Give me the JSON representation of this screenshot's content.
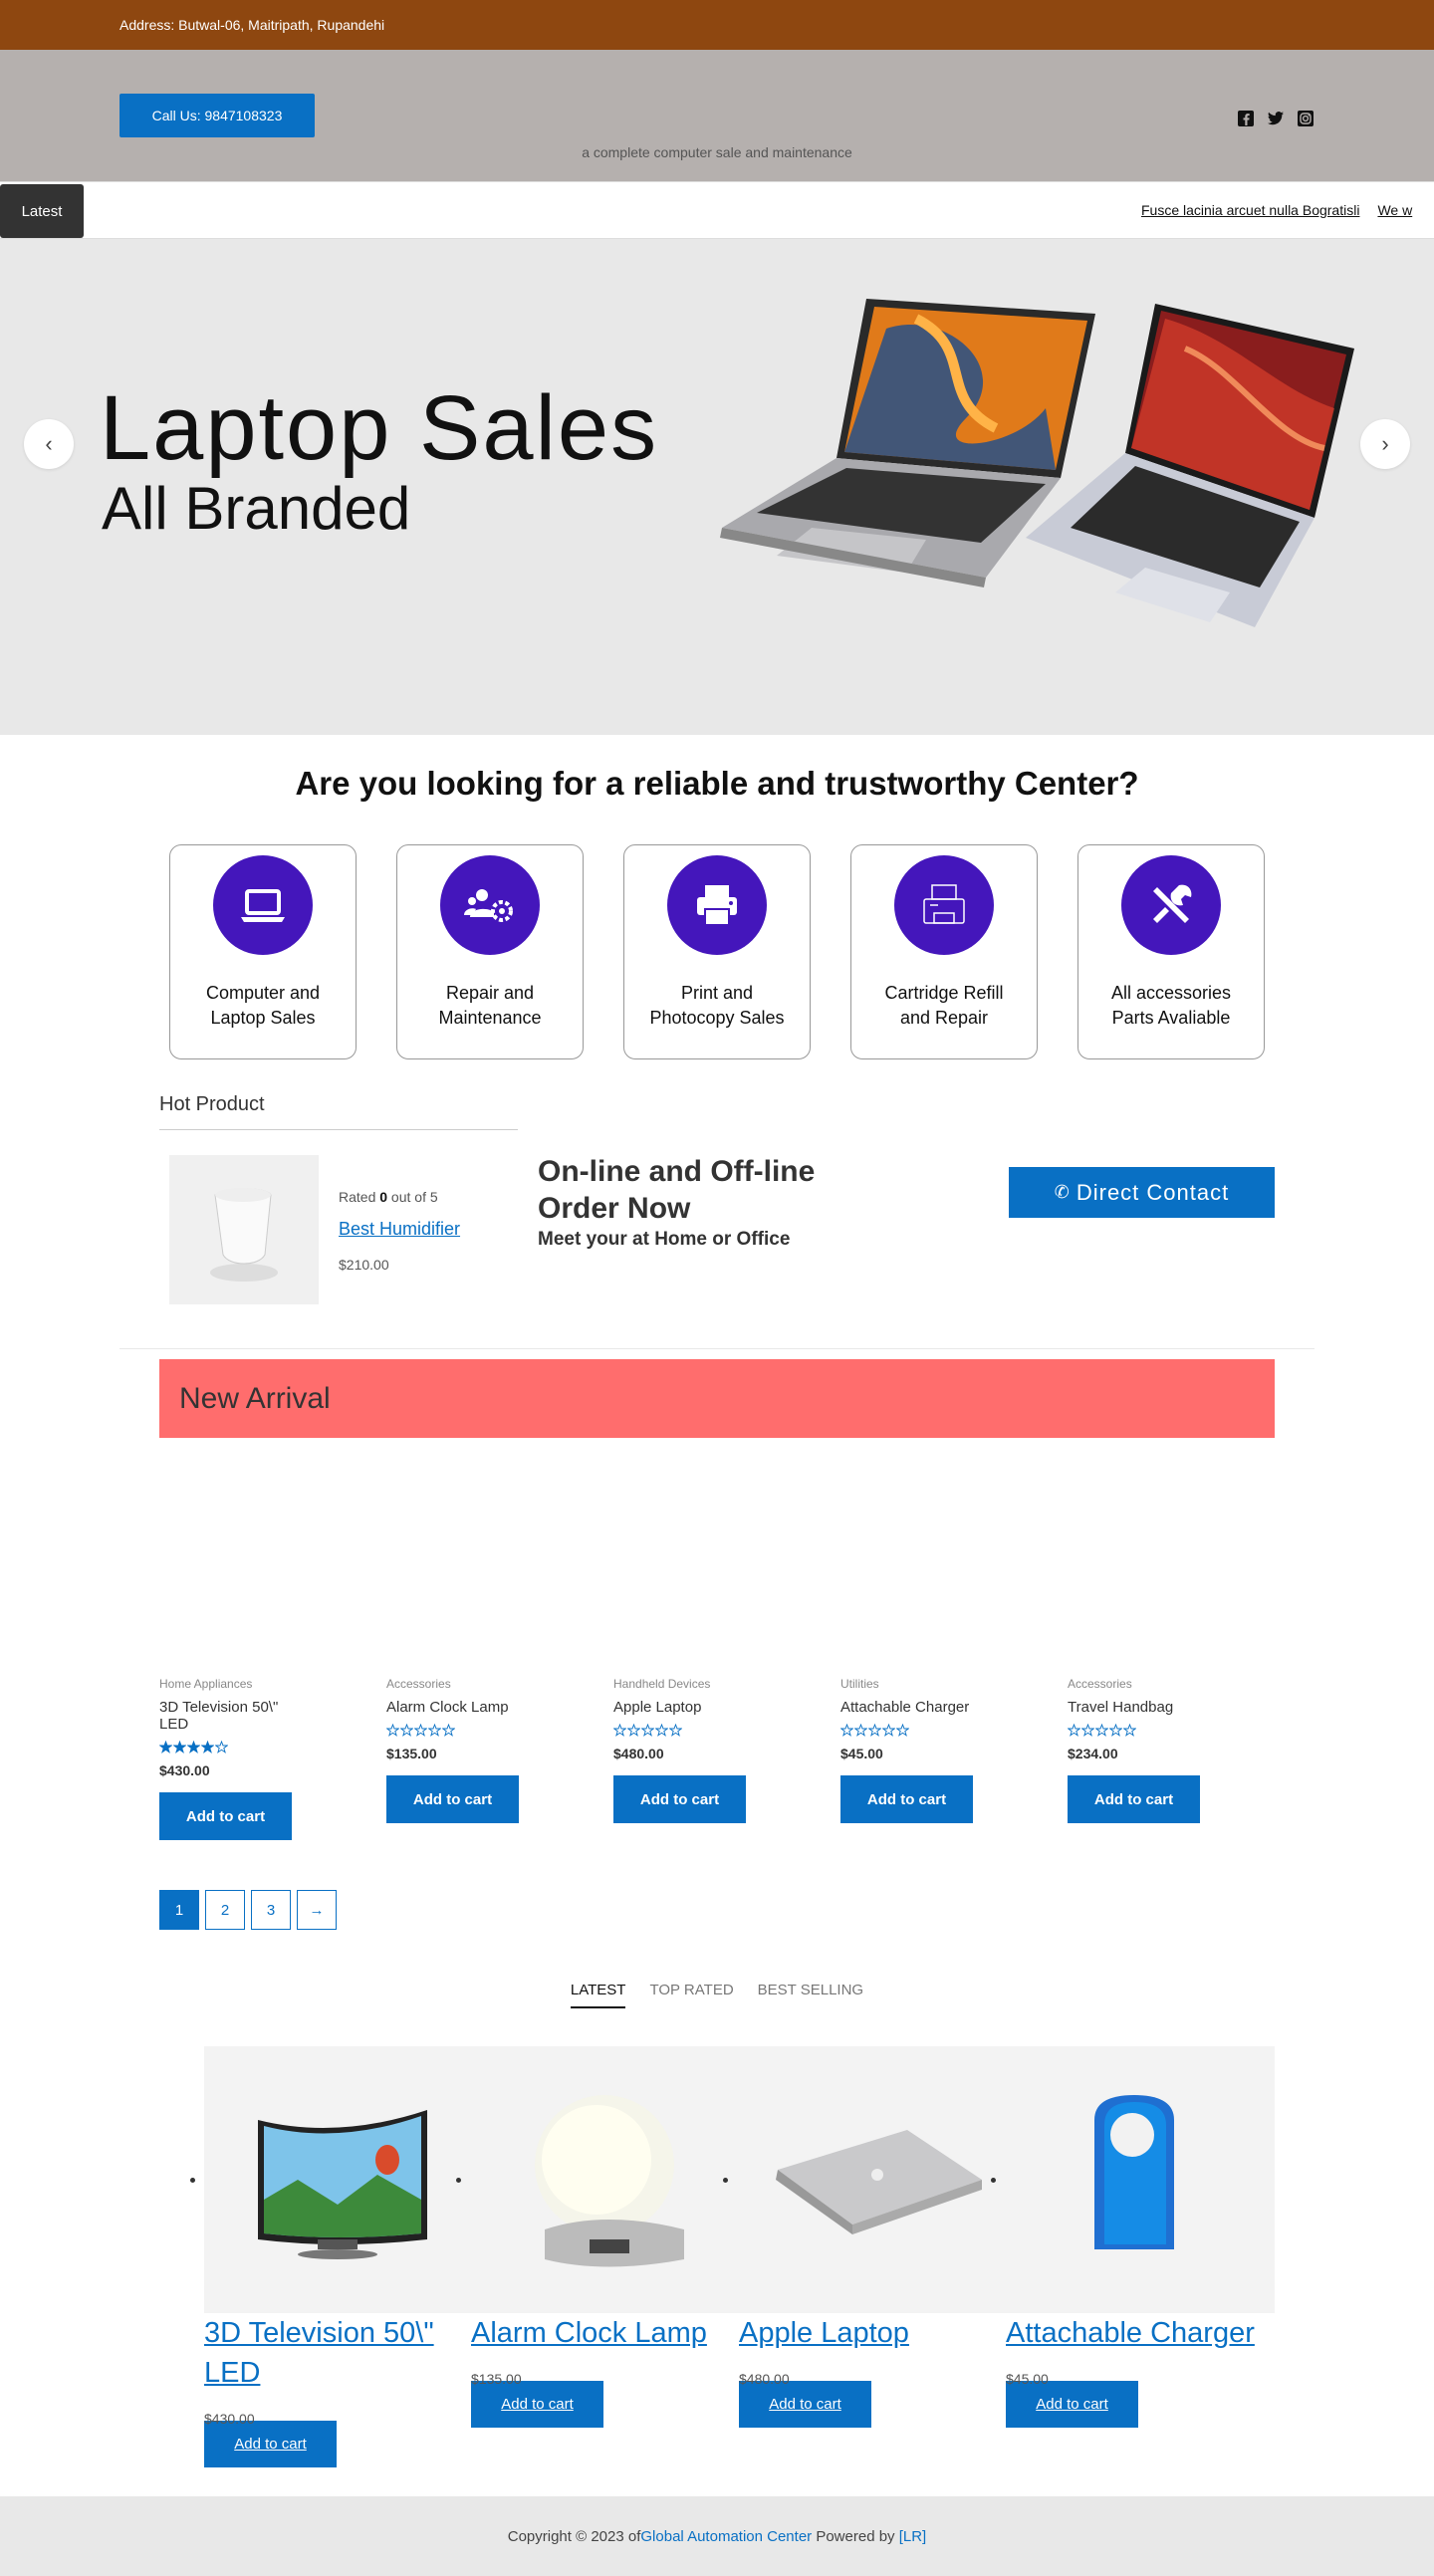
{
  "topbar": {
    "address": "Address: Butwal-06, Maitripath, Rupandehi"
  },
  "header": {
    "call_label": "Call Us: 9847108323",
    "tagline": "a complete computer sale and maintenance",
    "social_icons": [
      "facebook-icon",
      "twitter-icon",
      "instagram-icon"
    ]
  },
  "ticker": {
    "label": "Latest",
    "items": [
      "Fusce lacinia arcuet nulla Bogratisli",
      "We w"
    ]
  },
  "hero": {
    "line1": "Laptop Sales",
    "line2": "All Branded",
    "prev": "‹",
    "next": "›"
  },
  "services": {
    "title": "Are you looking for a reliable and trustworthy Center?",
    "items": [
      {
        "line1": "Computer and",
        "line2": "Laptop Sales",
        "icon": "laptop-icon"
      },
      {
        "line1": "Repair and",
        "line2": "Maintenance",
        "icon": "users-gear-icon"
      },
      {
        "line1": "Print and",
        "line2": "Photocopy Sales",
        "icon": "printer-icon"
      },
      {
        "line1": "Cartridge Refill",
        "line2": "and Repair",
        "icon": "fax-icon"
      },
      {
        "line1": "All accessories",
        "line2": "Parts Avaliable",
        "icon": "tools-icon"
      }
    ]
  },
  "hot": {
    "title": "Hot Product",
    "rated_prefix": "Rated ",
    "rated_value": "0",
    "rated_suffix": " out of 5",
    "name": "Best Humidifier",
    "price": "$210.00",
    "order_title_1": "On-line and Off-line",
    "order_title_2": "Order Now",
    "order_sub": "Meet your at Home or Office",
    "direct_label": "Direct Contact"
  },
  "new_arrival": {
    "title": "New Arrival",
    "products": [
      {
        "category": "Home Appliances",
        "name": "3D Television 50\\\" LED",
        "rating": 4,
        "price": "$430.00",
        "button": "Add to cart"
      },
      {
        "category": "Accessories",
        "name": "Alarm Clock Lamp",
        "rating": 0,
        "price": "$135.00",
        "button": "Add to cart"
      },
      {
        "category": "Handheld Devices",
        "name": "Apple Laptop",
        "rating": 0,
        "price": "$480.00",
        "button": "Add to cart"
      },
      {
        "category": "Utilities",
        "name": "Attachable Charger",
        "rating": 0,
        "price": "$45.00",
        "button": "Add to cart"
      },
      {
        "category": "Accessories",
        "name": "Travel Handbag",
        "rating": 0,
        "price": "$234.00",
        "button": "Add to cart"
      }
    ],
    "pages": [
      "1",
      "2",
      "3",
      "→"
    ]
  },
  "tabs": [
    "LATEST",
    "TOP RATED",
    "BEST SELLING"
  ],
  "carousel": [
    {
      "name": "3D Television 50\\\" LED",
      "price": "$430.00",
      "button": "Add to cart"
    },
    {
      "name": "Alarm Clock Lamp",
      "price": "$135.00",
      "button": "Add to cart"
    },
    {
      "name": "Apple Laptop",
      "price": "$480.00",
      "button": "Add to cart"
    },
    {
      "name": "Attachable Charger",
      "price": "$45.00",
      "button": "Add to cart"
    }
  ],
  "footer": {
    "prefix": "Copyright © 2023 of ",
    "link1": "Global Automation Center",
    "middle": " Powered by ",
    "link2": "[LR]"
  },
  "colors": {
    "accent": "#0970c4",
    "topbar": "#8e4710",
    "header": "#b5b0ae",
    "service_circle": "#4416bb",
    "banner": "#ff6d6d"
  }
}
